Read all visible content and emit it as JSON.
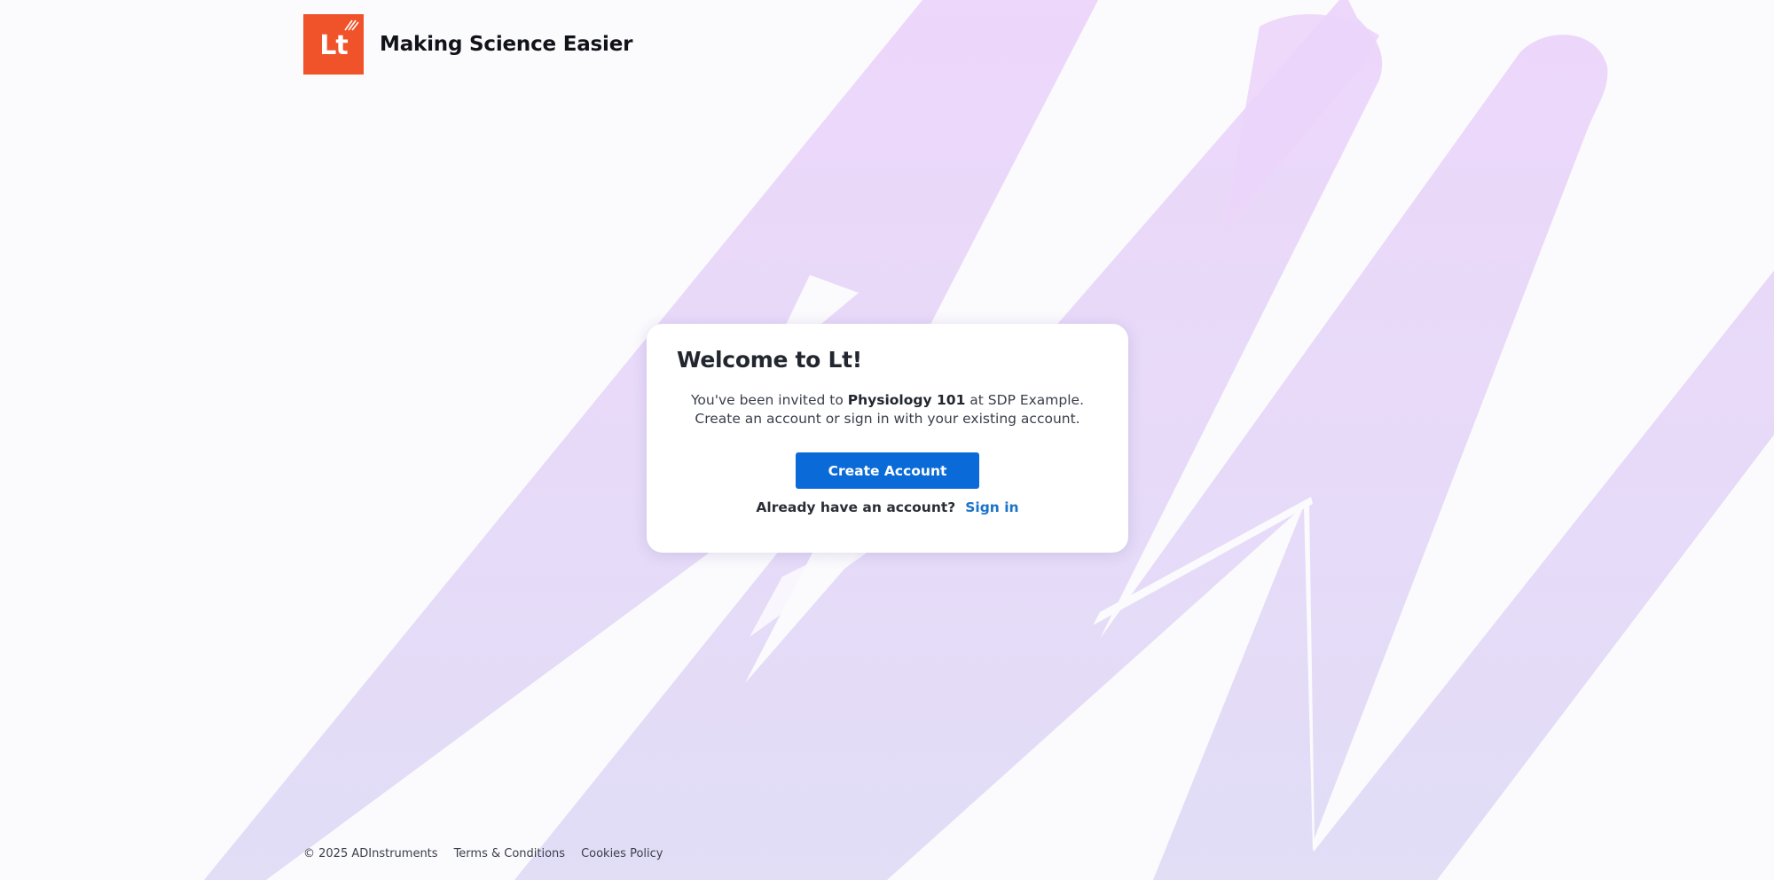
{
  "brand": {
    "logo_text": "Lt",
    "tagline": "Making Science Easier",
    "logo_color": "#f0532a"
  },
  "card": {
    "title": "Welcome to Lt!",
    "invite_prefix": "You've been invited to ",
    "course_name": "Physiology 101",
    "invite_suffix": " at SDP Example.",
    "instructions": "Create an account or sign in with your existing account.",
    "create_button_label": "Create Account",
    "signin_prompt": "Already have an account?",
    "signin_link_label": "Sign in"
  },
  "footer": {
    "copyright": "© 2025 ADInstruments",
    "terms_label": "Terms & Conditions",
    "cookies_label": "Cookies Policy"
  },
  "colors": {
    "primary_button": "#0a6bd8",
    "link": "#1a73c8",
    "background_art": "#e3d6f7"
  }
}
